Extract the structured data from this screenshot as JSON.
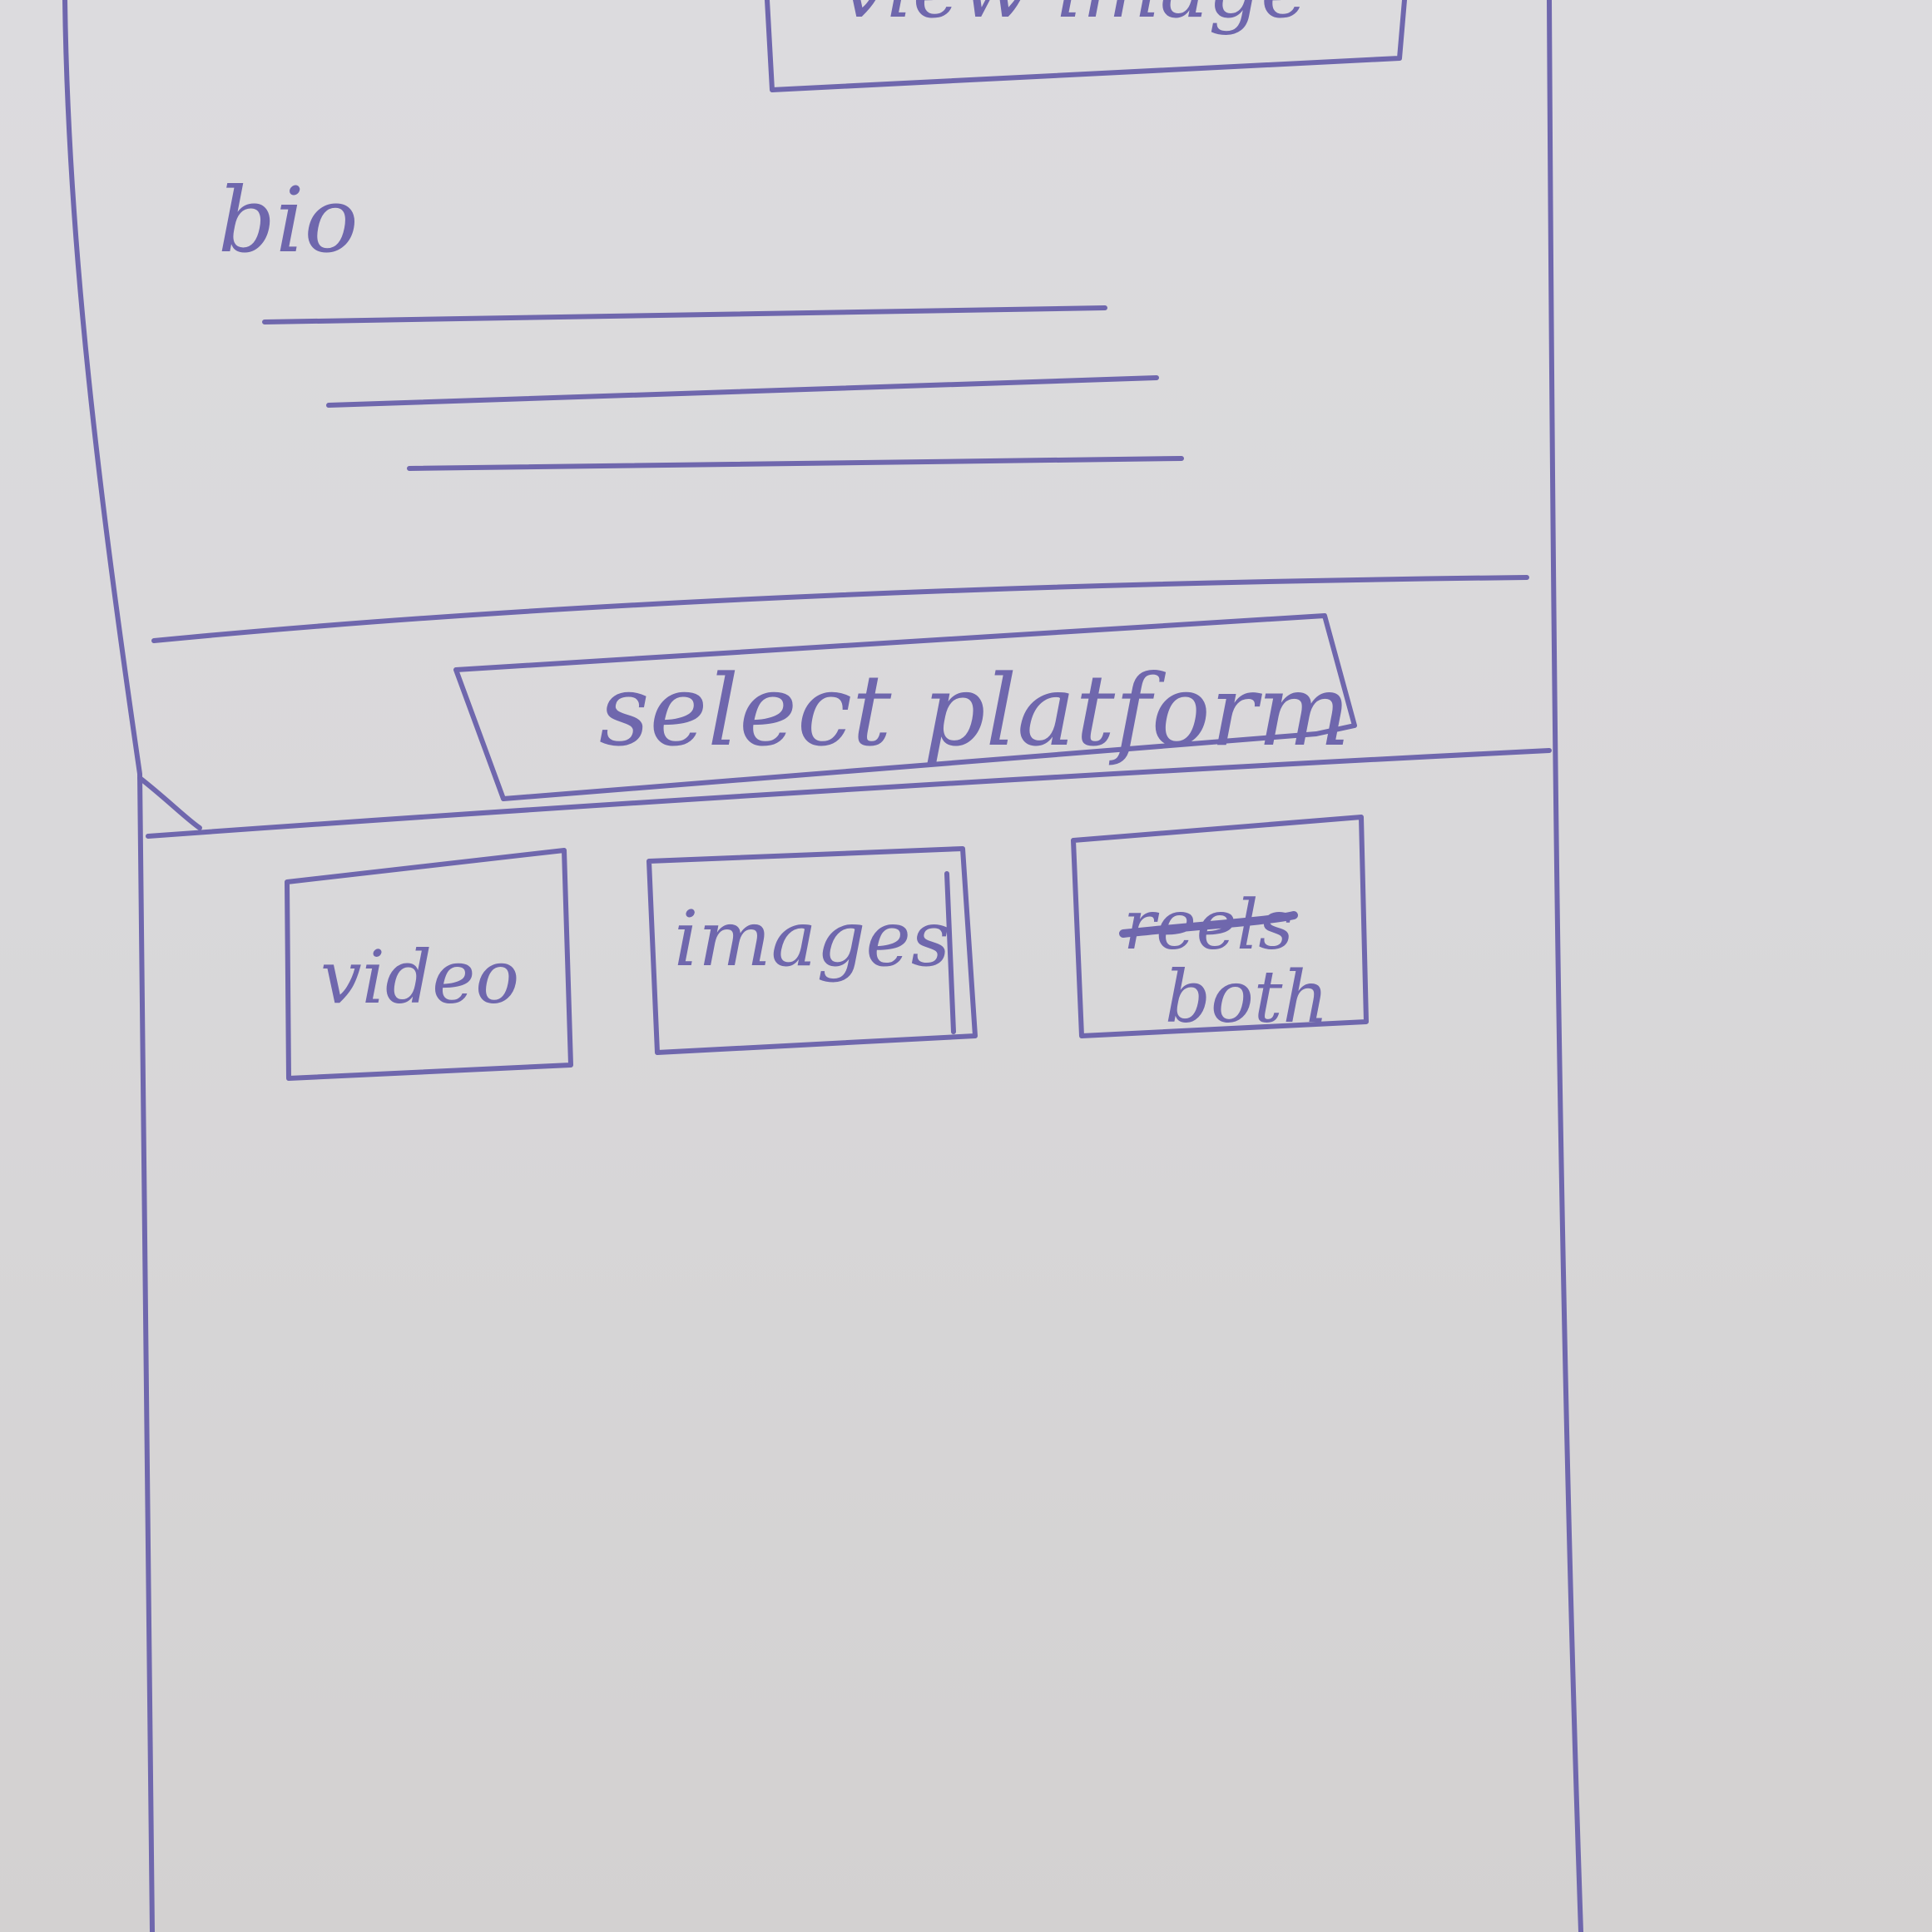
{
  "header": {
    "view_button_label": "view image"
  },
  "profile": {
    "bio_label": "bio"
  },
  "platform": {
    "select_label": "select platform"
  },
  "media_options": {
    "video_label": "video",
    "images_label": "images",
    "reels_label_crossed": "reels",
    "both_label": "both"
  },
  "colors": {
    "ink": "#6f67ad",
    "paper": "#d9d8da"
  }
}
